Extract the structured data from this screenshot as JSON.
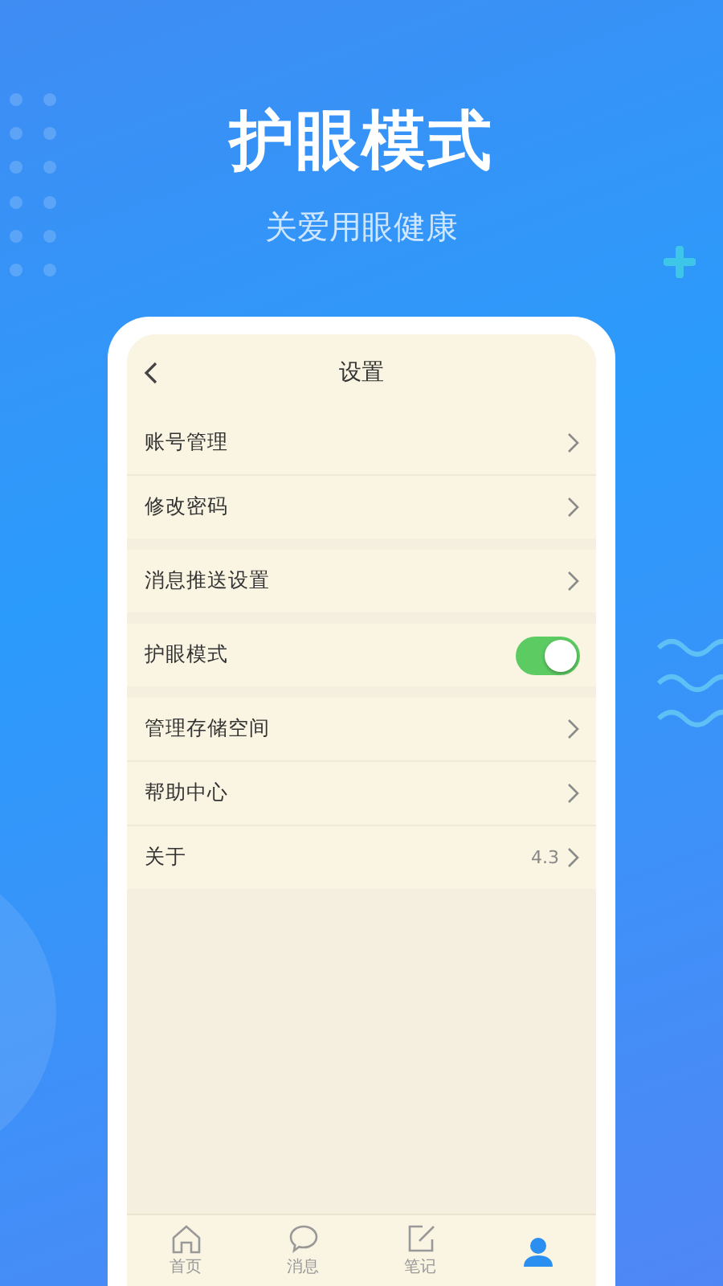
{
  "header": {
    "title": "护眼模式",
    "subtitle": "关爱用眼健康"
  },
  "screen": {
    "title": "设置",
    "groups": [
      {
        "rows": [
          {
            "kind": "link",
            "label": "账号管理"
          },
          {
            "kind": "link",
            "label": "修改密码"
          }
        ]
      },
      {
        "rows": [
          {
            "kind": "link",
            "label": "消息推送设置"
          }
        ]
      },
      {
        "rows": [
          {
            "kind": "toggle",
            "label": "护眼模式",
            "on": true
          }
        ]
      },
      {
        "rows": [
          {
            "kind": "link",
            "label": "管理存储空间"
          },
          {
            "kind": "link",
            "label": "帮助中心"
          },
          {
            "kind": "link",
            "label": "关于",
            "value": "4.3"
          }
        ]
      }
    ],
    "tab_bar": [
      {
        "kind": "home",
        "label": "首页",
        "selected": false
      },
      {
        "kind": "message",
        "label": "消息",
        "selected": false
      },
      {
        "kind": "note",
        "label": "笔记",
        "selected": false
      },
      {
        "kind": "profile",
        "selected": true
      }
    ]
  }
}
